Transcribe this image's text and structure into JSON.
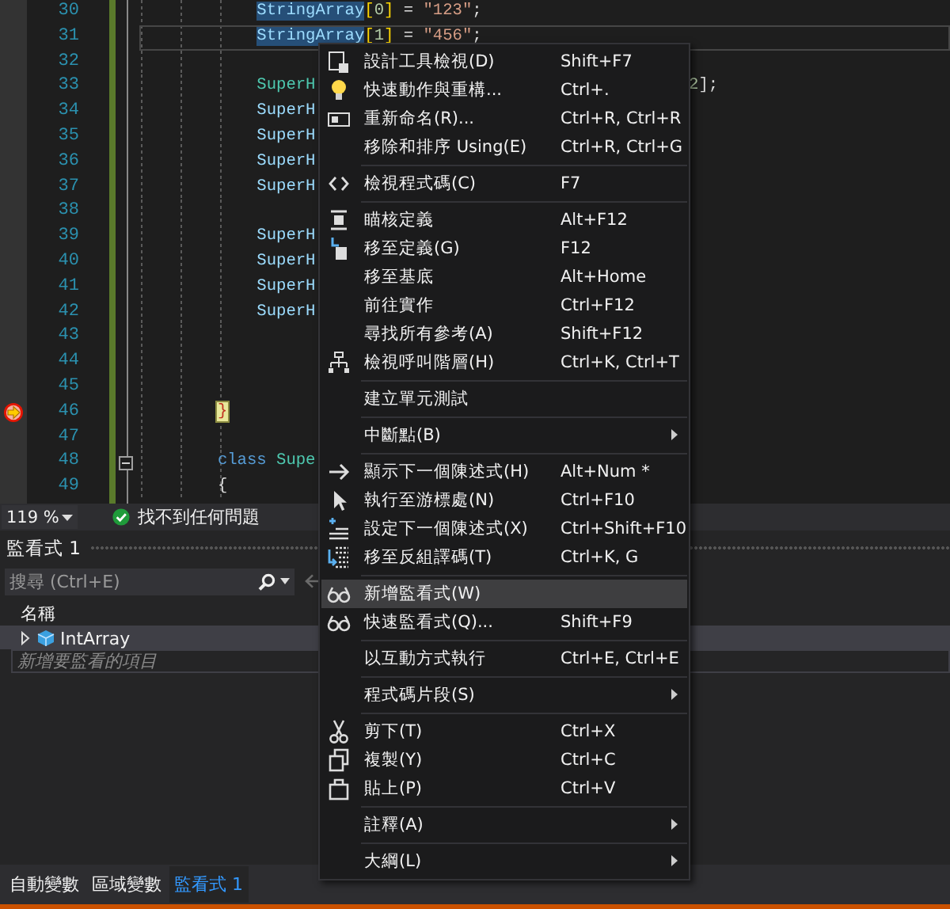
{
  "editor": {
    "lines": [
      {
        "number": "30",
        "tokens": [
          {
            "text": "            StringArray",
            "kind": "ident",
            "selected": true
          },
          {
            "text": "[",
            "kind": "bracket"
          },
          {
            "text": "0",
            "kind": "number"
          },
          {
            "text": "]",
            "kind": "bracket"
          },
          {
            "text": " = ",
            "kind": "plain"
          },
          {
            "text": "\"123\"",
            "kind": "string"
          },
          {
            "text": ";",
            "kind": "plain"
          }
        ]
      },
      {
        "number": "31",
        "current": true,
        "tokens": [
          {
            "text": "            StringArray",
            "kind": "ident",
            "selected": true
          },
          {
            "text": "[",
            "kind": "bracket"
          },
          {
            "text": "1",
            "kind": "number"
          },
          {
            "text": "]",
            "kind": "bracket"
          },
          {
            "text": " = ",
            "kind": "plain"
          },
          {
            "text": "\"456\"",
            "kind": "string"
          },
          {
            "text": ";",
            "kind": "plain"
          }
        ]
      },
      {
        "number": "32"
      },
      {
        "number": "33",
        "tokens": [
          {
            "text": "            SuperH",
            "kind": "class"
          }
        ],
        "tail": [
          {
            "text": "2",
            "kind": "number"
          },
          {
            "text": "];",
            "kind": "plain"
          }
        ]
      },
      {
        "number": "34",
        "tokens": [
          {
            "text": "            SuperH",
            "kind": "ident"
          }
        ]
      },
      {
        "number": "35",
        "tokens": [
          {
            "text": "            SuperH",
            "kind": "ident"
          }
        ]
      },
      {
        "number": "36",
        "tokens": [
          {
            "text": "            SuperH",
            "kind": "ident"
          }
        ]
      },
      {
        "number": "37",
        "tokens": [
          {
            "text": "            SuperH",
            "kind": "ident"
          }
        ]
      },
      {
        "number": "38"
      },
      {
        "number": "39",
        "tokens": [
          {
            "text": "            SuperH",
            "kind": "ident"
          }
        ]
      },
      {
        "number": "40",
        "tokens": [
          {
            "text": "            SuperH",
            "kind": "ident"
          }
        ]
      },
      {
        "number": "41",
        "tokens": [
          {
            "text": "            SuperH",
            "kind": "ident"
          }
        ]
      },
      {
        "number": "42",
        "tokens": [
          {
            "text": "            SuperH",
            "kind": "ident"
          }
        ]
      },
      {
        "number": "43"
      },
      {
        "number": "44"
      },
      {
        "number": "45"
      },
      {
        "number": "46",
        "execution_point": true,
        "tokens": [
          {
            "text": "        }",
            "kind": "bracket",
            "brace_match": true
          }
        ]
      },
      {
        "number": "47"
      },
      {
        "number": "48",
        "fold": true,
        "tokens": [
          {
            "text": "        class",
            "kind": "keyword"
          },
          {
            "text": " Supe",
            "kind": "class"
          }
        ]
      },
      {
        "number": "49",
        "tokens": [
          {
            "text": "        {",
            "kind": "plain"
          }
        ]
      }
    ]
  },
  "editor_status": {
    "zoom": "119 %",
    "issues": "找不到任何問題"
  },
  "watch_panel": {
    "title": "監看式 1",
    "search": {
      "placeholder": "搜尋 (Ctrl+E)"
    },
    "columns": [
      "名稱"
    ],
    "rows": [
      {
        "name": "IntArray",
        "expanded": false,
        "selected": true
      }
    ],
    "add_row": {
      "placeholder": "新增要監看的項目"
    }
  },
  "context_menu": {
    "items": [
      {
        "kind": "item",
        "label": "設計工具檢視(D)",
        "shortcut": "Shift+F7",
        "submenu": false,
        "selected": false
      },
      {
        "kind": "item",
        "label": "快速動作與重構...",
        "shortcut": "Ctrl+.",
        "submenu": false,
        "selected": false
      },
      {
        "kind": "item",
        "label": "重新命名(R)...",
        "shortcut": "Ctrl+R, Ctrl+R",
        "submenu": false,
        "selected": false
      },
      {
        "kind": "item",
        "label": "移除和排序 Using(E)",
        "shortcut": "Ctrl+R, Ctrl+G",
        "submenu": false,
        "selected": false
      },
      {
        "kind": "separator"
      },
      {
        "kind": "item",
        "label": "檢視程式碼(C)",
        "shortcut": "F7",
        "submenu": false,
        "selected": false
      },
      {
        "kind": "separator"
      },
      {
        "kind": "item",
        "label": "瞄核定義",
        "shortcut": "Alt+F12",
        "submenu": false,
        "selected": false
      },
      {
        "kind": "item",
        "label": "移至定義(G)",
        "shortcut": "F12",
        "submenu": false,
        "selected": false
      },
      {
        "kind": "item",
        "label": "移至基底",
        "shortcut": "Alt+Home",
        "submenu": false,
        "selected": false
      },
      {
        "kind": "item",
        "label": "前往實作",
        "shortcut": "Ctrl+F12",
        "submenu": false,
        "selected": false
      },
      {
        "kind": "item",
        "label": "尋找所有參考(A)",
        "shortcut": "Shift+F12",
        "submenu": false,
        "selected": false
      },
      {
        "kind": "item",
        "label": "檢視呼叫階層(H)",
        "shortcut": "Ctrl+K, Ctrl+T",
        "submenu": false,
        "selected": false
      },
      {
        "kind": "separator"
      },
      {
        "kind": "item",
        "label": "建立單元測試",
        "submenu": false,
        "selected": false
      },
      {
        "kind": "separator"
      },
      {
        "kind": "item",
        "label": "中斷點(B)",
        "submenu": true,
        "selected": false
      },
      {
        "kind": "separator"
      },
      {
        "kind": "item",
        "label": "顯示下一個陳述式(H)",
        "shortcut": "Alt+Num *",
        "submenu": false,
        "selected": false
      },
      {
        "kind": "item",
        "label": "執行至游標處(N)",
        "shortcut": "Ctrl+F10",
        "submenu": false,
        "selected": false
      },
      {
        "kind": "item",
        "label": "設定下一個陳述式(X)",
        "shortcut": "Ctrl+Shift+F10",
        "submenu": false,
        "selected": false
      },
      {
        "kind": "item",
        "label": "移至反組譯碼(T)",
        "shortcut": "Ctrl+K, G",
        "submenu": false,
        "selected": false
      },
      {
        "kind": "separator"
      },
      {
        "kind": "item",
        "label": "新增監看式(W)",
        "submenu": false,
        "selected": true
      },
      {
        "kind": "item",
        "label": "快速監看式(Q)...",
        "shortcut": "Shift+F9",
        "submenu": false,
        "selected": false
      },
      {
        "kind": "separator"
      },
      {
        "kind": "item",
        "label": "以互動方式執行",
        "shortcut": "Ctrl+E, Ctrl+E",
        "submenu": false,
        "selected": false
      },
      {
        "kind": "separator"
      },
      {
        "kind": "item",
        "label": "程式碼片段(S)",
        "submenu": true,
        "selected": false
      },
      {
        "kind": "separator"
      },
      {
        "kind": "item",
        "label": "剪下(T)",
        "shortcut": "Ctrl+X",
        "submenu": false,
        "selected": false
      },
      {
        "kind": "item",
        "label": "複製(Y)",
        "shortcut": "Ctrl+C",
        "submenu": false,
        "selected": false
      },
      {
        "kind": "item",
        "label": "貼上(P)",
        "shortcut": "Ctrl+V",
        "submenu": false,
        "selected": false
      },
      {
        "kind": "separator"
      },
      {
        "kind": "item",
        "label": "註釋(A)",
        "submenu": true,
        "selected": false
      },
      {
        "kind": "separator"
      },
      {
        "kind": "item",
        "label": "大綱(L)",
        "submenu": true,
        "selected": false
      }
    ]
  },
  "bottom_tabs": [
    {
      "label": "自動變數",
      "selected": false
    },
    {
      "label": "區域變數",
      "selected": false
    },
    {
      "label": "監看式 1",
      "selected": true
    }
  ]
}
